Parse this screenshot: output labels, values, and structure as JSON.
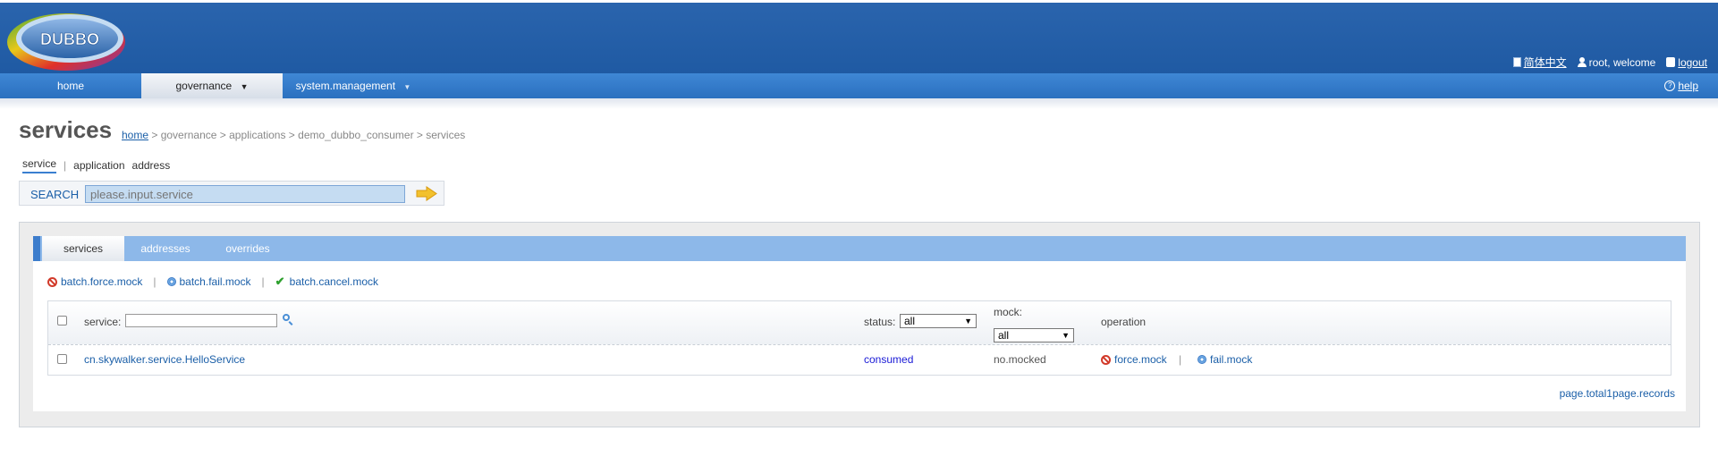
{
  "brand": {
    "logo_text": "DUBBO"
  },
  "header_links": {
    "language": "简体中文",
    "user": "root, welcome",
    "logout": "logout"
  },
  "nav": {
    "items": [
      {
        "label": "home"
      },
      {
        "label": "governance"
      },
      {
        "label": "system.management"
      }
    ],
    "help": "help"
  },
  "page": {
    "title": "services",
    "breadcrumb": {
      "home": "home",
      "rest": " > governance > applications > demo_dubbo_consumer > services"
    }
  },
  "search": {
    "tabs": [
      "service",
      "application",
      "address"
    ],
    "separator": "|",
    "label": "SEARCH",
    "placeholder": "please.input.service"
  },
  "panel": {
    "tabs": [
      "services",
      "addresses",
      "overrides"
    ],
    "batch": {
      "force_mock": "batch.force.mock",
      "fail_mock": "batch.fail.mock",
      "cancel_mock": "batch.cancel.mock",
      "separator": "|"
    },
    "table": {
      "headers": {
        "service": "service:",
        "status": "status:",
        "status_value": "all",
        "mock": "mock:",
        "mock_value": "all",
        "operation": "operation"
      },
      "rows": [
        {
          "service": "cn.skywalker.service.HelloService",
          "status": "consumed",
          "mock": "no.mocked",
          "op_force": "force.mock",
          "op_fail": "fail.mock",
          "op_sep": "|"
        }
      ]
    },
    "pager": "page.total1page.records"
  },
  "colors": {
    "header": "#2a64ad",
    "nav": "#3f87d5",
    "tabbar": "#8db8e9",
    "link": "#1b5fa8",
    "consumed": "#1a1ad6"
  }
}
